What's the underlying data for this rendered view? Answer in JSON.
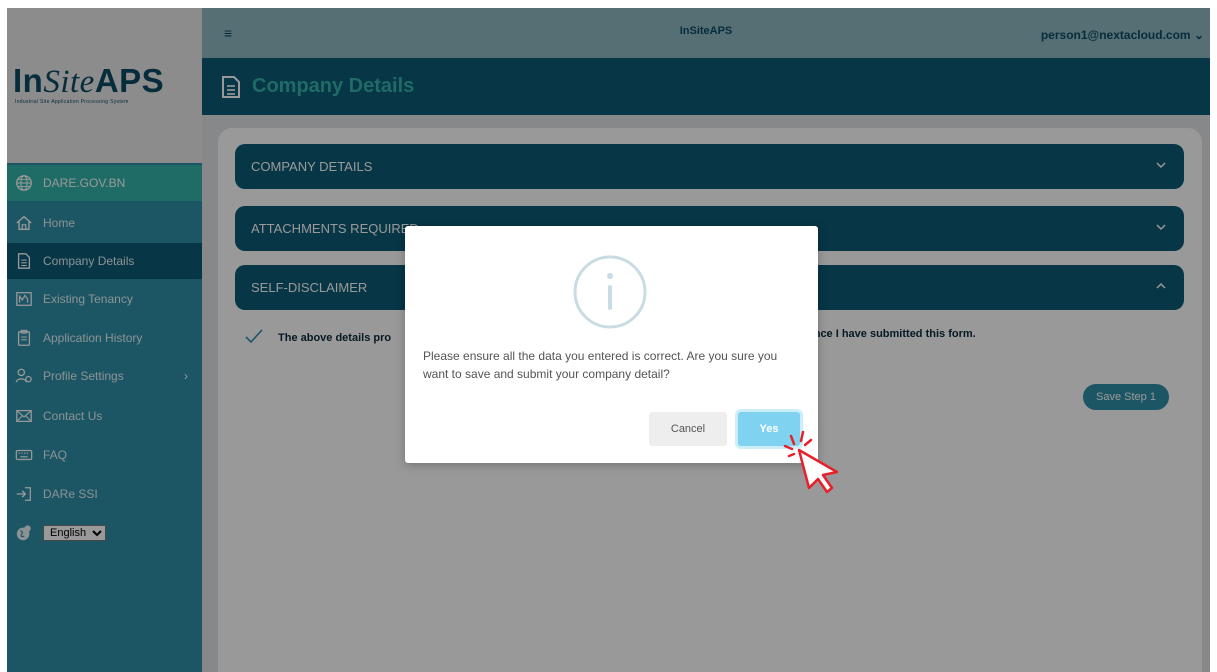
{
  "app": {
    "title": "InSiteAPS",
    "user_email": "person1@nextacloud.com",
    "user_caret": "⌄",
    "menu_glyph": "≡"
  },
  "logo": {
    "prefix": "In",
    "italic": "Site",
    "suffix": "APS",
    "subtitle": "Industrial Site Application Processing System"
  },
  "sidebar": {
    "site": {
      "label": "DARE.GOV.BN",
      "icon": "globe-icon"
    },
    "items": [
      {
        "label": "Home",
        "icon": "home-icon",
        "active": false
      },
      {
        "label": "Company Details",
        "icon": "document-icon",
        "active": true
      },
      {
        "label": "Existing Tenancy",
        "icon": "chart-icon",
        "active": false
      },
      {
        "label": "Application History",
        "icon": "history-icon",
        "active": false
      },
      {
        "label": "Profile Settings",
        "icon": "users-icon",
        "active": false,
        "has_submenu": true,
        "submenu_glyph": "›"
      },
      {
        "label": "Contact Us",
        "icon": "mail-icon",
        "active": false
      },
      {
        "label": "FAQ",
        "icon": "keyboard-icon",
        "active": false
      },
      {
        "label": "DARe SSI",
        "icon": "login-icon",
        "active": false
      }
    ],
    "language": {
      "selected": "English",
      "options": [
        "English"
      ],
      "icon": "language-globe-icon"
    }
  },
  "page": {
    "title": "Company Details",
    "title_icon": "document-icon"
  },
  "sections": [
    {
      "title": "COMPANY DETAILS",
      "expanded": false
    },
    {
      "title": "ATTACHMENTS REQUIRED",
      "expanded": false
    },
    {
      "title": "SELF-DISCLAIMER",
      "expanded": true
    }
  ],
  "disclaimer": {
    "start": "The above details pro",
    "end": "once I have submitted this form.",
    "checked": true
  },
  "save_step_label": "Save Step 1",
  "dialog": {
    "icon": "info-icon",
    "message": "Please ensure all the data you entered is correct. Are you sure you want to save and submit your company detail?",
    "cancel_label": "Cancel",
    "confirm_label": "Yes"
  },
  "colors": {
    "sidebar": "#2f8fa8",
    "header": "#0c5a75",
    "accent": "#34b3ab",
    "confirm_button": "#7fd2f0",
    "cursor": "#e8202a"
  }
}
